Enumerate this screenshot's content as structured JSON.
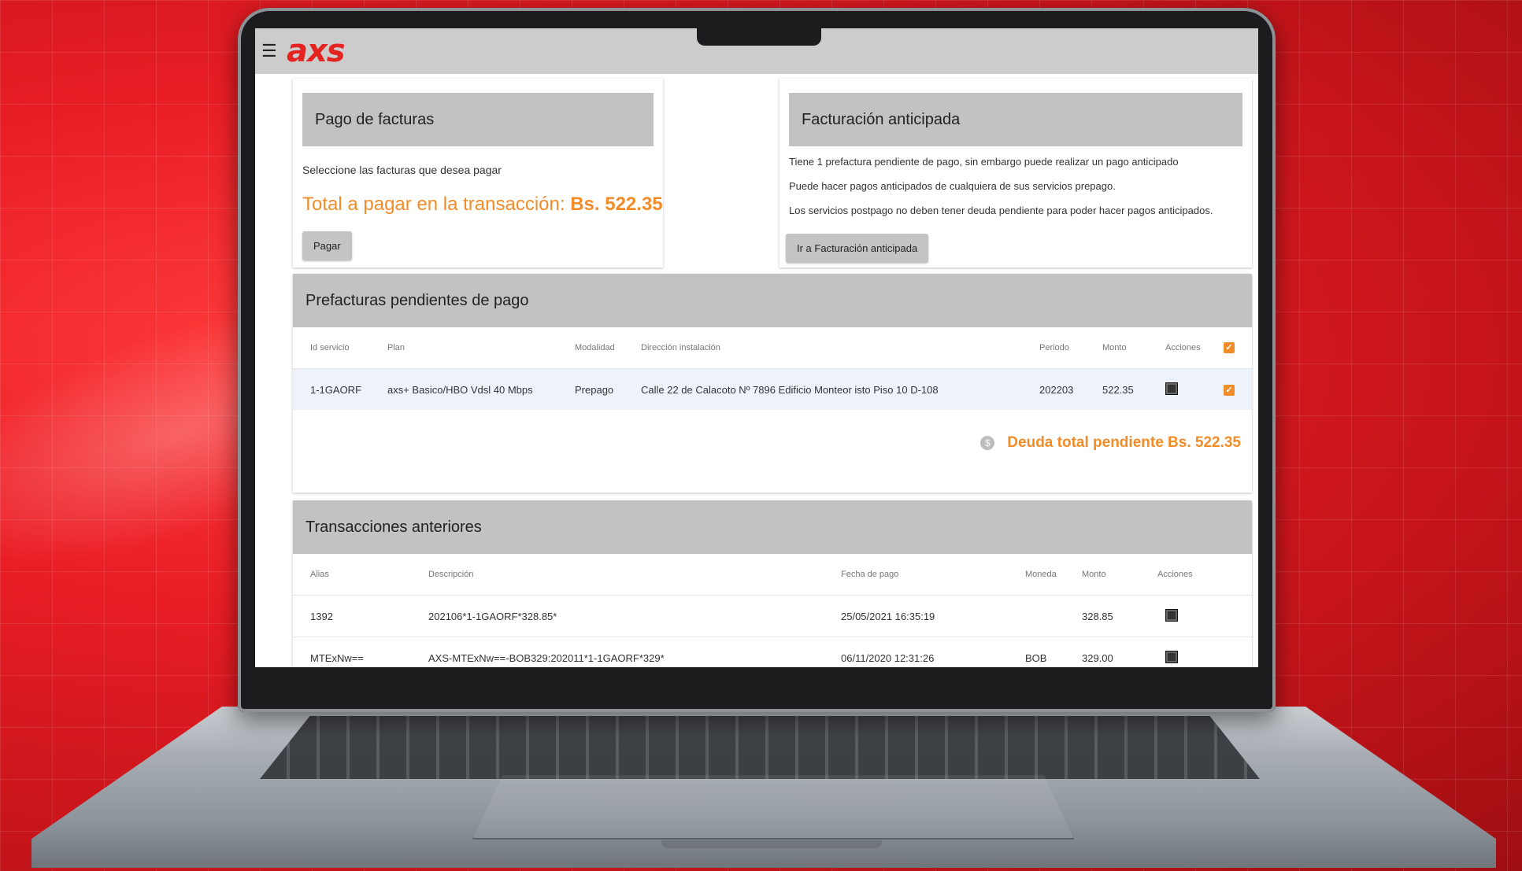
{
  "app": {
    "logo_text": "axs",
    "menu_icon": "hamburger-icon"
  },
  "pago": {
    "title": "Pago de facturas",
    "subtitle": "Seleccione las facturas que desea pagar",
    "total_label": "Total a pagar en la transacción:",
    "total_value": "Bs. 522.35",
    "button": "Pagar"
  },
  "anticipada": {
    "title": "Facturación anticipada",
    "line1": "Tiene 1 prefactura pendiente de pago, sin embargo puede realizar un pago anticipado",
    "line2": "Puede hacer pagos anticipados de cualquiera de sus servicios prepago.",
    "line3": "Los servicios postpago no deben tener deuda pendiente para poder hacer pagos anticipados.",
    "button": "Ir a Facturación anticipada"
  },
  "prefacturas": {
    "title": "Prefacturas pendientes de pago",
    "columns": [
      "Id servicio",
      "Plan",
      "Modalidad",
      "Dirección instalación",
      "Periodo",
      "Monto",
      "Acciones"
    ],
    "rows": [
      {
        "id": "1-1GAORF",
        "plan": "axs+ Basico/HBO Vdsl 40 Mbps",
        "modalidad": "Prepago",
        "direccion": "Calle 22 de Calacoto Nº 7896 Edificio Monteor isto Piso 10 D-108",
        "periodo": "202203",
        "monto": "522.35",
        "checked": true
      }
    ],
    "debt_label": "Deuda total pendiente Bs. 522.35",
    "debt_icon": "dollar-coin-icon"
  },
  "transacciones": {
    "title": "Transacciones anteriores",
    "columns": [
      "Alias",
      "Descripción",
      "Fecha de pago",
      "Moneda",
      "Monto",
      "Acciones"
    ],
    "rows": [
      {
        "alias": "1392",
        "descripcion": "202106*1-1GAORF*328.85*",
        "fecha": "25/05/2021 16:35:19",
        "moneda": "",
        "monto": "328.85"
      },
      {
        "alias": "MTExNw==",
        "descripcion": "AXS-MTExNw==-BOB329:202011*1-1GAORF*329*",
        "fecha": "06/11/2020 12:31:26",
        "moneda": "BOB",
        "monto": "329.00"
      }
    ]
  },
  "colors": {
    "brand": "#e52320",
    "accent": "#f28c28",
    "header_gray": "#c2c2c2"
  }
}
